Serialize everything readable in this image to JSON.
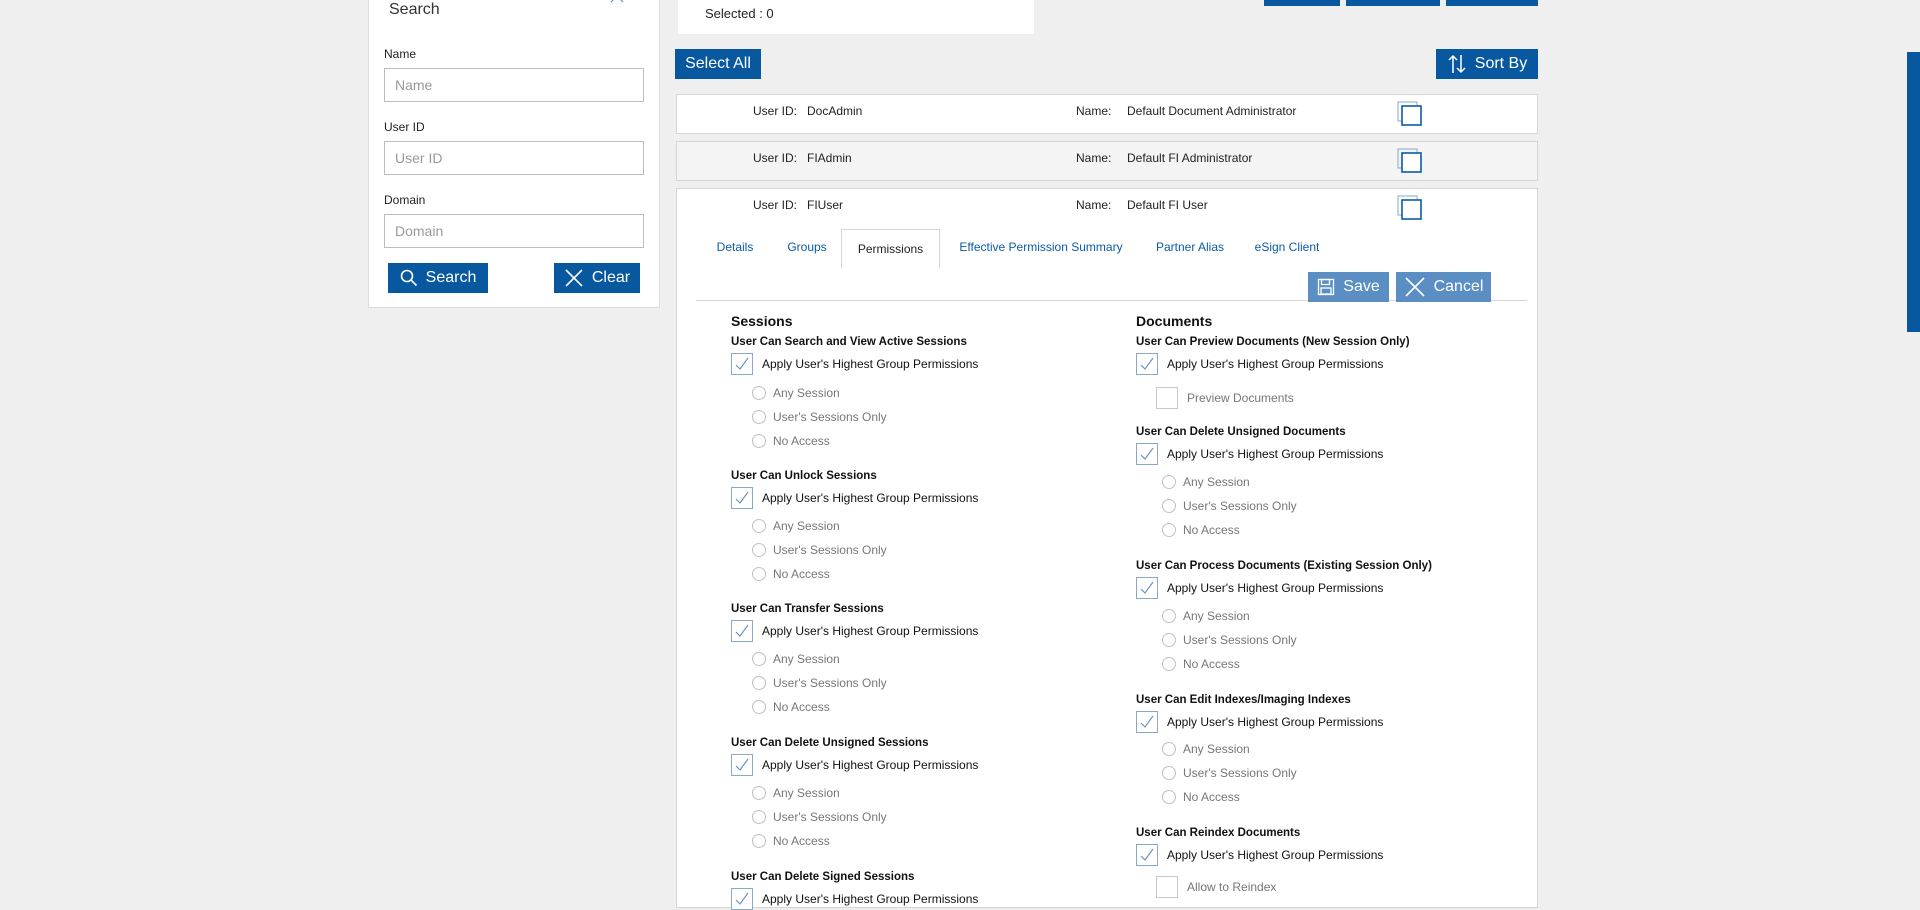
{
  "search": {
    "title": "Search",
    "name_label": "Name",
    "name_placeholder": "Name",
    "userid_label": "User ID",
    "userid_placeholder": "User ID",
    "domain_label": "Domain",
    "domain_placeholder": "Domain",
    "search_button": "Search",
    "clear_button": "Clear"
  },
  "toolbar": {
    "selected_text": "Selected : 0",
    "select_all": "Select All",
    "sort_by": "Sort By"
  },
  "users": [
    {
      "userid_label": "User ID:",
      "userid": "DocAdmin",
      "name_label": "Name:",
      "name": "Default Document Administrator"
    },
    {
      "userid_label": "User ID:",
      "userid": "FIAdmin",
      "name_label": "Name:",
      "name": "Default FI Administrator"
    },
    {
      "userid_label": "User ID:",
      "userid": "FIUser",
      "name_label": "Name:",
      "name": "Default FI User"
    }
  ],
  "tabs": [
    "Details",
    "Groups",
    "Permissions",
    "Effective Permission Summary",
    "Partner Alias",
    "eSign Client"
  ],
  "actions": {
    "save": "Save",
    "cancel": "Cancel"
  },
  "apply_label": "Apply User's Highest Group Permissions",
  "radio_options": [
    "Any Session",
    "User's Sessions Only",
    "No Access"
  ],
  "sessions": {
    "title": "Sessions",
    "perms": [
      "User Can Search and View Active Sessions",
      "User Can Unlock Sessions",
      "User Can Transfer Sessions",
      "User Can Delete Unsigned Sessions",
      "User Can Delete Signed Sessions"
    ]
  },
  "documents": {
    "title": "Documents",
    "perms": [
      "User Can Preview Documents (New Session Only)",
      "User Can Delete Unsigned Documents",
      "User Can Process Documents (Existing Session Only)",
      "User Can Edit Indexes/Imaging Indexes",
      "User Can Reindex Documents"
    ],
    "preview_option": "Preview Documents",
    "reindex_option": "Allow to Reindex"
  }
}
